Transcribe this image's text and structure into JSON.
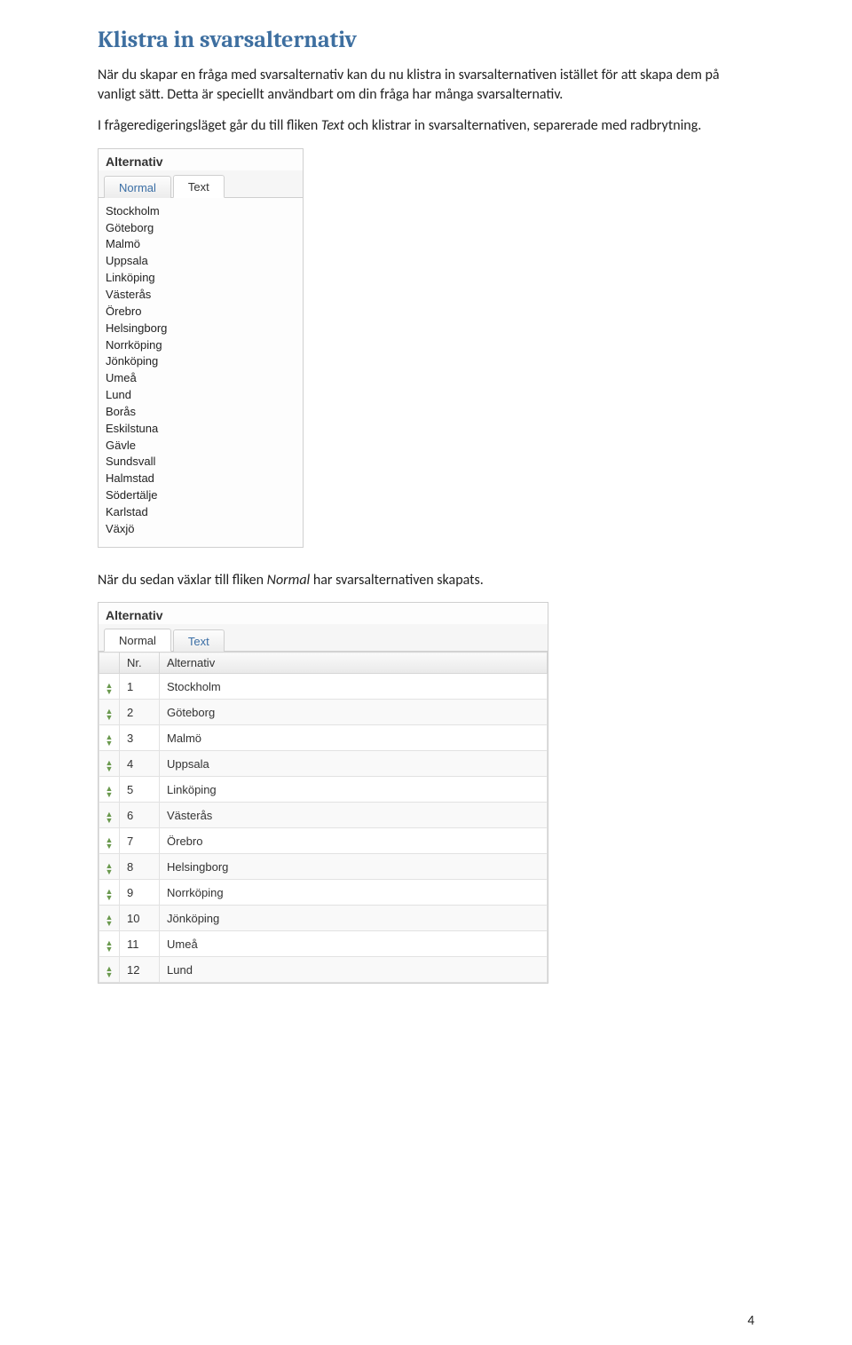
{
  "heading": "Klistra in svarsalternativ",
  "para1_a": "När du skapar en fråga med svarsalternativ kan du nu klistra in svarsalternativen istället för att skapa dem på vanligt sätt. Detta är speciellt användbart om din fråga har många svarsalternativ.",
  "para2_a": "I frågeredigeringsläget går du till fliken ",
  "para2_em": "Text",
  "para2_b": " och klistrar in svarsalternativen, separerade med radbrytning.",
  "panel1": {
    "title": "Alternativ",
    "tab_normal": "Normal",
    "tab_text": "Text",
    "cities": [
      "Stockholm",
      "Göteborg",
      "Malmö",
      "Uppsala",
      "Linköping",
      "Västerås",
      "Örebro",
      "Helsingborg",
      "Norrköping",
      "Jönköping",
      "Umeå",
      "Lund",
      "Borås",
      "Eskilstuna",
      "Gävle",
      "Sundsvall",
      "Halmstad",
      "Södertälje",
      "Karlstad",
      "Växjö"
    ]
  },
  "para3_a": "När du sedan växlar till fliken ",
  "para3_em": "Normal",
  "para3_b": " har svarsalternativen skapats.",
  "panel2": {
    "title": "Alternativ",
    "tab_normal": "Normal",
    "tab_text": "Text",
    "col_nr": "Nr.",
    "col_alt": "Alternativ",
    "rows": [
      {
        "nr": "1",
        "alt": "Stockholm"
      },
      {
        "nr": "2",
        "alt": "Göteborg"
      },
      {
        "nr": "3",
        "alt": "Malmö"
      },
      {
        "nr": "4",
        "alt": "Uppsala"
      },
      {
        "nr": "5",
        "alt": "Linköping"
      },
      {
        "nr": "6",
        "alt": "Västerås"
      },
      {
        "nr": "7",
        "alt": "Örebro"
      },
      {
        "nr": "8",
        "alt": "Helsingborg"
      },
      {
        "nr": "9",
        "alt": "Norrköping"
      },
      {
        "nr": "10",
        "alt": "Jönköping"
      },
      {
        "nr": "11",
        "alt": "Umeå"
      },
      {
        "nr": "12",
        "alt": "Lund"
      }
    ]
  },
  "page_number": "4"
}
